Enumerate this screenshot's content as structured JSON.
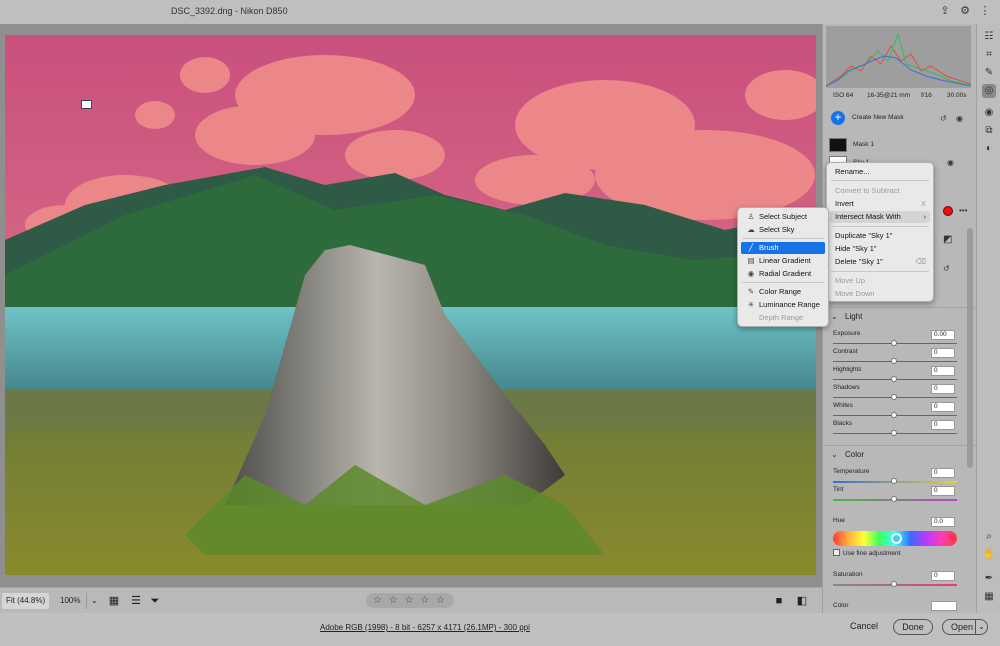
{
  "window": {
    "title": "DSC_3392.dng  -  Nikon D850",
    "share_icon": "share-icon",
    "settings_icon": "gear-icon",
    "more_icon": "more-vertical-icon"
  },
  "toolbar": {
    "zoom_fit": "Fit (44.8%)",
    "zoom_100": "100%",
    "zoom_chevron": "⌄",
    "rating_stars": "☆ ☆ ☆ ☆ ☆"
  },
  "footer": {
    "doc_info": "Adobe RGB (1998) - 8 bit - 6257 x 4171 (26.1MP) - 300 ppi",
    "cancel": "Cancel",
    "done": "Done",
    "open": "Open",
    "open_chevron": "⌄"
  },
  "panel": {
    "camera": {
      "iso": "ISO 64",
      "lens": "16-35@21 mm",
      "aperture": "f/16",
      "shutter": "30.00s"
    },
    "masks": {
      "create_label": "Create New Mask",
      "items": [
        {
          "label": "Mask 1"
        },
        {
          "label": "Sky 1"
        }
      ]
    },
    "light": {
      "title": "Light",
      "sliders": [
        {
          "label": "Exposure",
          "value": "0.00"
        },
        {
          "label": "Contrast",
          "value": "0"
        },
        {
          "label": "Highlights",
          "value": "0"
        },
        {
          "label": "Shadows",
          "value": "0"
        },
        {
          "label": "Whites",
          "value": "0"
        },
        {
          "label": "Blacks",
          "value": "0"
        }
      ]
    },
    "color": {
      "title": "Color",
      "temperature": {
        "label": "Temperature",
        "value": "0"
      },
      "tint": {
        "label": "Tint",
        "value": "0"
      },
      "hue": {
        "label": "Hue",
        "value": "0.0"
      },
      "fine_adjust": "Use fine adjustment",
      "saturation": {
        "label": "Saturation",
        "value": "0"
      },
      "color_label": "Color"
    }
  },
  "context_menu": {
    "items": [
      {
        "label": "Rename...",
        "disabled": false
      },
      {
        "label": "Convert to Subtract",
        "disabled": true
      },
      {
        "label": "Invert",
        "shortcut": "X",
        "disabled": false
      },
      {
        "label": "Intersect Mask With",
        "submenu": true,
        "disabled": false
      },
      {
        "label": "Duplicate \"Sky 1\"",
        "disabled": false
      },
      {
        "label": "Hide \"Sky 1\"",
        "disabled": false
      },
      {
        "label": "Delete \"Sky 1\"",
        "disabled": false
      },
      {
        "label": "Move Up",
        "disabled": true
      },
      {
        "label": "Move Down",
        "disabled": true
      }
    ]
  },
  "add_menu": {
    "items": [
      {
        "label": "Select Subject",
        "icon": "person-icon"
      },
      {
        "label": "Select Sky",
        "icon": "sky-icon"
      },
      {
        "label": "Brush",
        "icon": "brush-icon",
        "highlighted": true
      },
      {
        "label": "Linear Gradient",
        "icon": "linear-gradient-icon"
      },
      {
        "label": "Radial Gradient",
        "icon": "radial-gradient-icon"
      },
      {
        "label": "Color Range",
        "icon": "color-range-icon"
      },
      {
        "label": "Luminance Range",
        "icon": "luminance-range-icon"
      },
      {
        "label": "Depth Range",
        "icon": "depth-range-icon",
        "disabled": true
      }
    ]
  },
  "colors": {
    "accent": "#1672e6",
    "mask_overlay": "#e0727a",
    "mask_color_dot": "#e11111"
  }
}
